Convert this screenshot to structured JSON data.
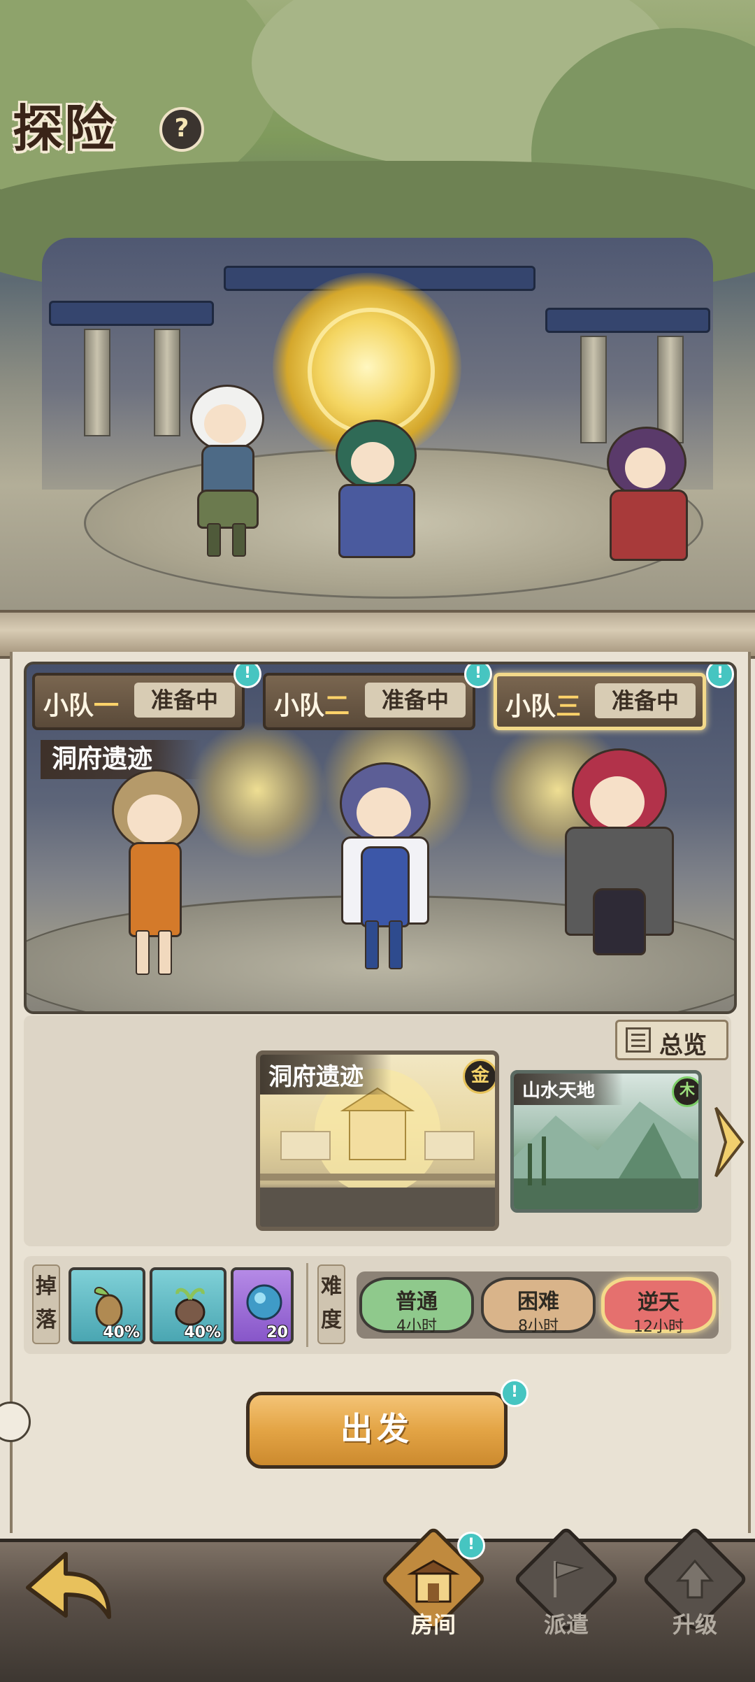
{
  "header": {
    "title": "探险",
    "help": "?"
  },
  "teams": [
    {
      "prefix": "小队",
      "num": "一",
      "status": "准备中",
      "active": false
    },
    {
      "prefix": "小队",
      "num": "二",
      "status": "准备中",
      "active": false
    },
    {
      "prefix": "小队",
      "num": "三",
      "status": "准备中",
      "active": true
    }
  ],
  "alert_mark": "!",
  "current_location": "洞府遗迹",
  "map_selector": {
    "overview_label": "总览",
    "maps": [
      {
        "name": "洞府遗迹",
        "element": "金",
        "selected": true
      },
      {
        "name": "山水天地",
        "element": "木",
        "selected": false
      }
    ]
  },
  "drops": {
    "label_1": "掉",
    "label_2": "落",
    "items": [
      {
        "icon": "seed-sprout-icon",
        "chance": "40%"
      },
      {
        "icon": "bulb-sprout-icon",
        "chance": "40%"
      },
      {
        "icon": "blue-orb-icon",
        "chance": "20"
      }
    ]
  },
  "difficulty": {
    "label_1": "难",
    "label_2": "度",
    "options": [
      {
        "name": "普通",
        "time": "4小时",
        "color": "#8fc98c",
        "selected": false
      },
      {
        "name": "困难",
        "time": "8小时",
        "color": "#d9b48a",
        "selected": false
      },
      {
        "name": "逆天",
        "time": "12小时",
        "color": "#e5706e",
        "selected": true
      }
    ]
  },
  "depart_label": "出发",
  "nav": {
    "room": "房间",
    "dispatch": "派遣",
    "upgrade": "升级"
  },
  "colors": {
    "accent_gold": "#f3d98a",
    "alert_teal": "#46c5c1",
    "depart_orange": "#e3a445"
  }
}
